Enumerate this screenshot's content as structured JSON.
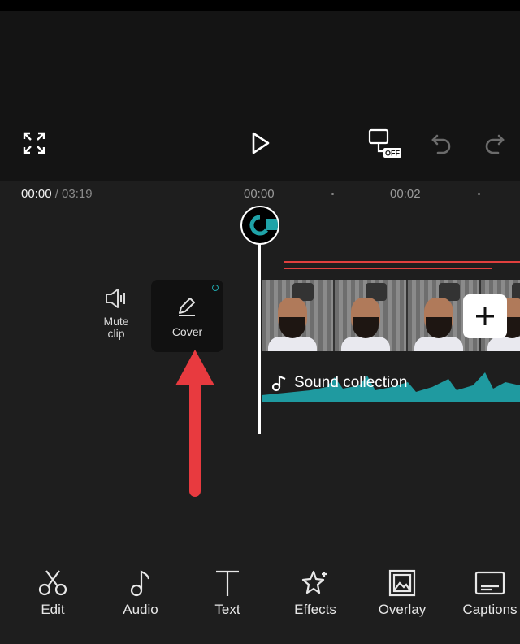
{
  "timeline": {
    "current_time": "00:00",
    "total_time": "/ 03:19",
    "ticks": [
      "00:00",
      "00:02"
    ]
  },
  "clip_actions": {
    "mute_label_line1": "Mute",
    "mute_label_line2": "clip",
    "cover_label": "Cover"
  },
  "audio_track": {
    "label": "Sound collection"
  },
  "toolbar": {
    "items": [
      {
        "label": "Edit",
        "icon": "scissors-icon"
      },
      {
        "label": "Audio",
        "icon": "music-note-icon"
      },
      {
        "label": "Text",
        "icon": "text-icon"
      },
      {
        "label": "Effects",
        "icon": "sparkle-star-icon"
      },
      {
        "label": "Overlay",
        "icon": "overlay-icon"
      },
      {
        "label": "Captions",
        "icon": "captions-icon"
      }
    ]
  },
  "colors": {
    "accent_teal": "#1fa3a8",
    "arrow_red": "#e83a3f",
    "track_red": "#e0403e"
  }
}
